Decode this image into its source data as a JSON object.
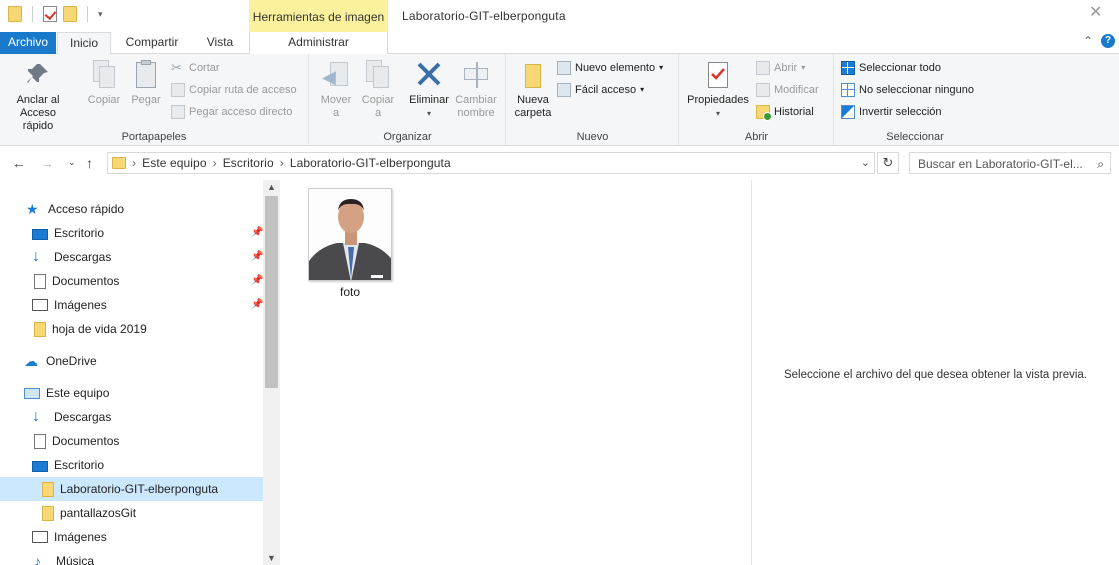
{
  "window": {
    "title": "Laboratorio-GIT-elberponguta",
    "context_tab_group": "Herramientas de imagen"
  },
  "tabs": [
    "Archivo",
    "Inicio",
    "Compartir",
    "Vista",
    "Administrar"
  ],
  "ribbon": {
    "portapapeles": {
      "label": "Portapapeles",
      "pin_label": "Anclar al\nAcceso rápido",
      "copy": "Copiar",
      "paste": "Pegar",
      "cut": "Cortar",
      "copy_path": "Copiar ruta de acceso",
      "paste_shortcut": "Pegar acceso directo"
    },
    "organizar": {
      "label": "Organizar",
      "move": "Mover\na",
      "copy_to": "Copiar\na",
      "delete": "Eliminar",
      "rename": "Cambiar\nnombre"
    },
    "nuevo": {
      "label": "Nuevo",
      "new_folder": "Nueva\ncarpeta",
      "new_item": "Nuevo elemento",
      "easy_access": "Fácil acceso"
    },
    "abrir": {
      "label": "Abrir",
      "properties": "Propiedades",
      "open": "Abrir",
      "edit": "Modificar",
      "history": "Historial"
    },
    "seleccionar": {
      "label": "Seleccionar",
      "select_all": "Seleccionar todo",
      "select_none": "No seleccionar ninguno",
      "invert": "Invertir selección"
    }
  },
  "address": {
    "crumbs": [
      "Este equipo",
      "Escritorio",
      "Laboratorio-GIT-elberponguta"
    ],
    "search_placeholder": "Buscar en Laboratorio-GIT-el..."
  },
  "nav": {
    "items": [
      {
        "label": "Acceso rápido",
        "icon": "star-icon"
      },
      {
        "label": "Escritorio",
        "icon": "desktop-icon",
        "pinned": true
      },
      {
        "label": "Descargas",
        "icon": "download-icon",
        "pinned": true
      },
      {
        "label": "Documentos",
        "icon": "document-icon",
        "pinned": true
      },
      {
        "label": "Imágenes",
        "icon": "pictures-icon",
        "pinned": true
      },
      {
        "label": "hoja de vida 2019",
        "icon": "folder-icon"
      },
      {
        "label": "OneDrive",
        "icon": "cloud-icon"
      },
      {
        "label": "Este equipo",
        "icon": "computer-icon"
      },
      {
        "label": "Descargas",
        "icon": "download-icon"
      },
      {
        "label": "Documentos",
        "icon": "document-icon"
      },
      {
        "label": "Escritorio",
        "icon": "desktop-icon"
      },
      {
        "label": "Laboratorio-GIT-elberponguta",
        "icon": "folder-icon",
        "selected": true
      },
      {
        "label": "pantallazosGit",
        "icon": "folder-icon"
      },
      {
        "label": "Imágenes",
        "icon": "pictures-icon"
      },
      {
        "label": "Música",
        "icon": "music-icon"
      }
    ]
  },
  "content": {
    "files": [
      {
        "name": "foto",
        "type": "image"
      }
    ]
  },
  "preview": {
    "message": "Seleccione el archivo del que desea obtener la vista previa."
  },
  "colors": {
    "accent": "#1979ca",
    "context_tab": "#fbf19d",
    "selection": "#cce8ff"
  }
}
